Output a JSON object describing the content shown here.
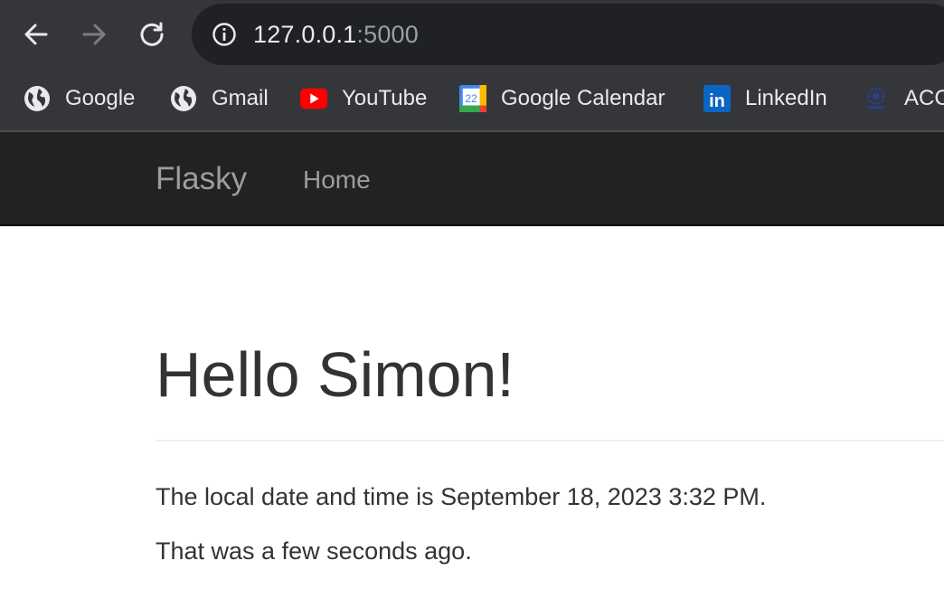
{
  "browser": {
    "url_host": "127.0.0.1",
    "url_port": ":5000",
    "bookmarks": [
      {
        "label": "Google",
        "icon": "globe-icon"
      },
      {
        "label": "Gmail",
        "icon": "globe-icon"
      },
      {
        "label": "YouTube",
        "icon": "youtube-icon"
      },
      {
        "label": "Google Calendar",
        "icon": "calendar-icon",
        "icon_text": "22"
      },
      {
        "label": "LinkedIn",
        "icon": "linkedin-icon",
        "icon_text": "in"
      },
      {
        "label": "ACC",
        "icon": "acc-logo-icon"
      }
    ]
  },
  "navbar": {
    "brand": "Flasky",
    "links": [
      {
        "label": "Home"
      }
    ]
  },
  "main": {
    "title": "Hello Simon!",
    "date_line": "The local date and time is September 18, 2023 3:32 PM.",
    "relative_line": "That was a few seconds ago."
  },
  "colors": {
    "chrome_bg": "#35363a",
    "omnibox_bg": "#202124",
    "navbar_bg": "#222222",
    "navbar_text": "#9d9d9d",
    "body_text": "#333333"
  }
}
